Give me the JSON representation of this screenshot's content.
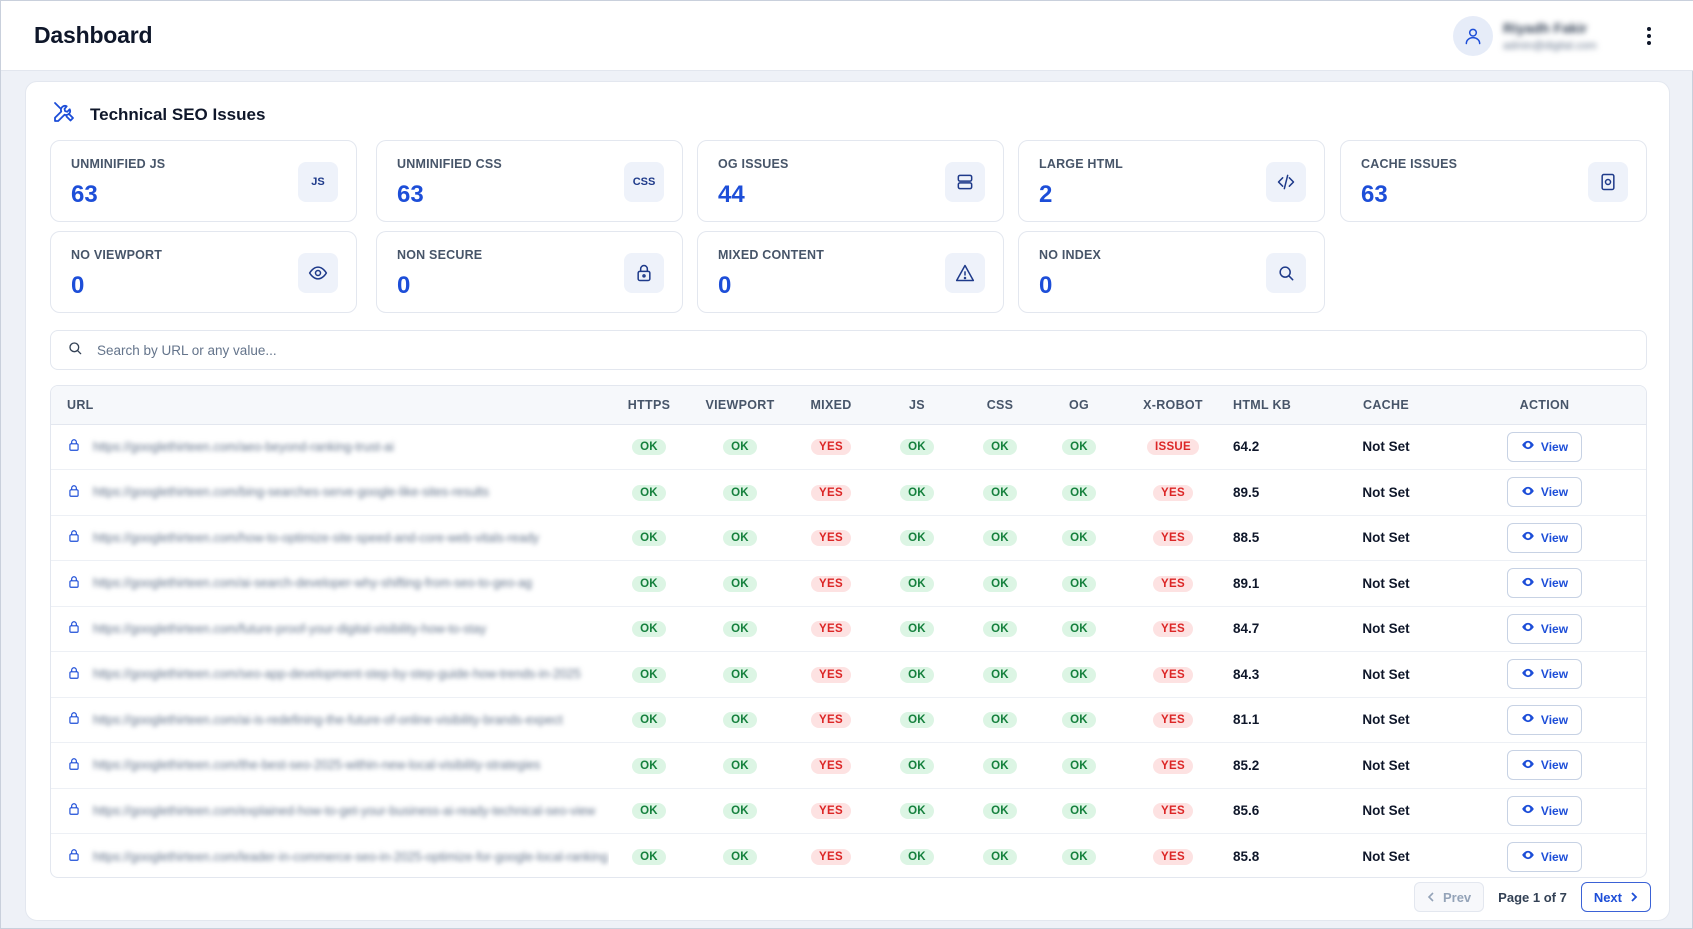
{
  "header": {
    "title": "Dashboard",
    "user_name": "Riyadh Fakir",
    "user_email": "admin@digital.com"
  },
  "section": {
    "title": "Technical SEO Issues"
  },
  "stats": [
    {
      "label": "UNMINIFIED JS",
      "value": "63",
      "icon": "JS"
    },
    {
      "label": "UNMINIFIED CSS",
      "value": "63",
      "icon": "CSS"
    },
    {
      "label": "OG ISSUES",
      "value": "44",
      "icon": "stack-icon"
    },
    {
      "label": "LARGE HTML",
      "value": "2",
      "icon": "code-icon"
    },
    {
      "label": "CACHE ISSUES",
      "value": "63",
      "icon": "cache-icon"
    },
    {
      "label": "NO VIEWPORT",
      "value": "0",
      "icon": "eye-icon"
    },
    {
      "label": "NON SECURE",
      "value": "0",
      "icon": "lock-icon"
    },
    {
      "label": "MIXED CONTENT",
      "value": "0",
      "icon": "warning-icon"
    },
    {
      "label": "NO INDEX",
      "value": "0",
      "icon": "search-icon"
    }
  ],
  "search": {
    "placeholder": "Search by URL or any value..."
  },
  "table": {
    "columns": [
      "URL",
      "HTTPS",
      "VIEWPORT",
      "MIXED",
      "JS",
      "CSS",
      "OG",
      "X-ROBOT",
      "HTML KB",
      "CACHE",
      "ACTION"
    ],
    "rows": [
      {
        "url": "https://googlethirteen.com/aeo-beyond-ranking-trust-ai",
        "https": "OK",
        "viewport": "OK",
        "mixed": "YES",
        "js": "OK",
        "css": "OK",
        "og": "OK",
        "xrobot": "ISSUE",
        "html_kb": "64.2",
        "cache": "Not Set",
        "action": "View"
      },
      {
        "url": "https://googlethirteen.com/bing-searches-serve-google-like-sites-results",
        "https": "OK",
        "viewport": "OK",
        "mixed": "YES",
        "js": "OK",
        "css": "OK",
        "og": "OK",
        "xrobot": "YES",
        "html_kb": "89.5",
        "cache": "Not Set",
        "action": "View"
      },
      {
        "url": "https://googlethirteen.com/how-to-optimize-site-speed-and-core-web-vitals-ready",
        "https": "OK",
        "viewport": "OK",
        "mixed": "YES",
        "js": "OK",
        "css": "OK",
        "og": "OK",
        "xrobot": "YES",
        "html_kb": "88.5",
        "cache": "Not Set",
        "action": "View"
      },
      {
        "url": "https://googlethirteen.com/ai-search-developer-why-shifting-from-seo-to-geo-ag",
        "https": "OK",
        "viewport": "OK",
        "mixed": "YES",
        "js": "OK",
        "css": "OK",
        "og": "OK",
        "xrobot": "YES",
        "html_kb": "89.1",
        "cache": "Not Set",
        "action": "View"
      },
      {
        "url": "https://googlethirteen.com/future-proof-your-digital-visibility-how-to-stay",
        "https": "OK",
        "viewport": "OK",
        "mixed": "YES",
        "js": "OK",
        "css": "OK",
        "og": "OK",
        "xrobot": "YES",
        "html_kb": "84.7",
        "cache": "Not Set",
        "action": "View"
      },
      {
        "url": "https://googlethirteen.com/seo-app-development-step-by-step-guide-how-trends-in-2025",
        "https": "OK",
        "viewport": "OK",
        "mixed": "YES",
        "js": "OK",
        "css": "OK",
        "og": "OK",
        "xrobot": "YES",
        "html_kb": "84.3",
        "cache": "Not Set",
        "action": "View"
      },
      {
        "url": "https://googlethirteen.com/ai-is-redefining-the-future-of-online-visibility-brands-expect",
        "https": "OK",
        "viewport": "OK",
        "mixed": "YES",
        "js": "OK",
        "css": "OK",
        "og": "OK",
        "xrobot": "YES",
        "html_kb": "81.1",
        "cache": "Not Set",
        "action": "View"
      },
      {
        "url": "https://googlethirteen.com/the-best-seo-2025-within-new-local-visibility-strategies",
        "https": "OK",
        "viewport": "OK",
        "mixed": "YES",
        "js": "OK",
        "css": "OK",
        "og": "OK",
        "xrobot": "YES",
        "html_kb": "85.2",
        "cache": "Not Set",
        "action": "View"
      },
      {
        "url": "https://googlethirteen.com/explained-how-to-get-your-business-ai-ready-technical-seo-view",
        "https": "OK",
        "viewport": "OK",
        "mixed": "YES",
        "js": "OK",
        "css": "OK",
        "og": "OK",
        "xrobot": "YES",
        "html_kb": "85.6",
        "cache": "Not Set",
        "action": "View"
      },
      {
        "url": "https://googlethirteen.com/leader-in-commerce-seo-in-2025-optimize-for-google-local-ranking",
        "https": "OK",
        "viewport": "OK",
        "mixed": "YES",
        "js": "OK",
        "css": "OK",
        "og": "OK",
        "xrobot": "YES",
        "html_kb": "85.8",
        "cache": "Not Set",
        "action": "View"
      }
    ]
  },
  "pagination": {
    "prev_label": "Prev",
    "page_text": "Page 1 of 7",
    "next_label": "Next"
  },
  "colors": {
    "accent": "#1d4ed8",
    "ok_bg": "#dcf5e4",
    "ok_text": "#15803d",
    "bad_bg": "#fde2e2",
    "bad_text": "#dc2626"
  }
}
